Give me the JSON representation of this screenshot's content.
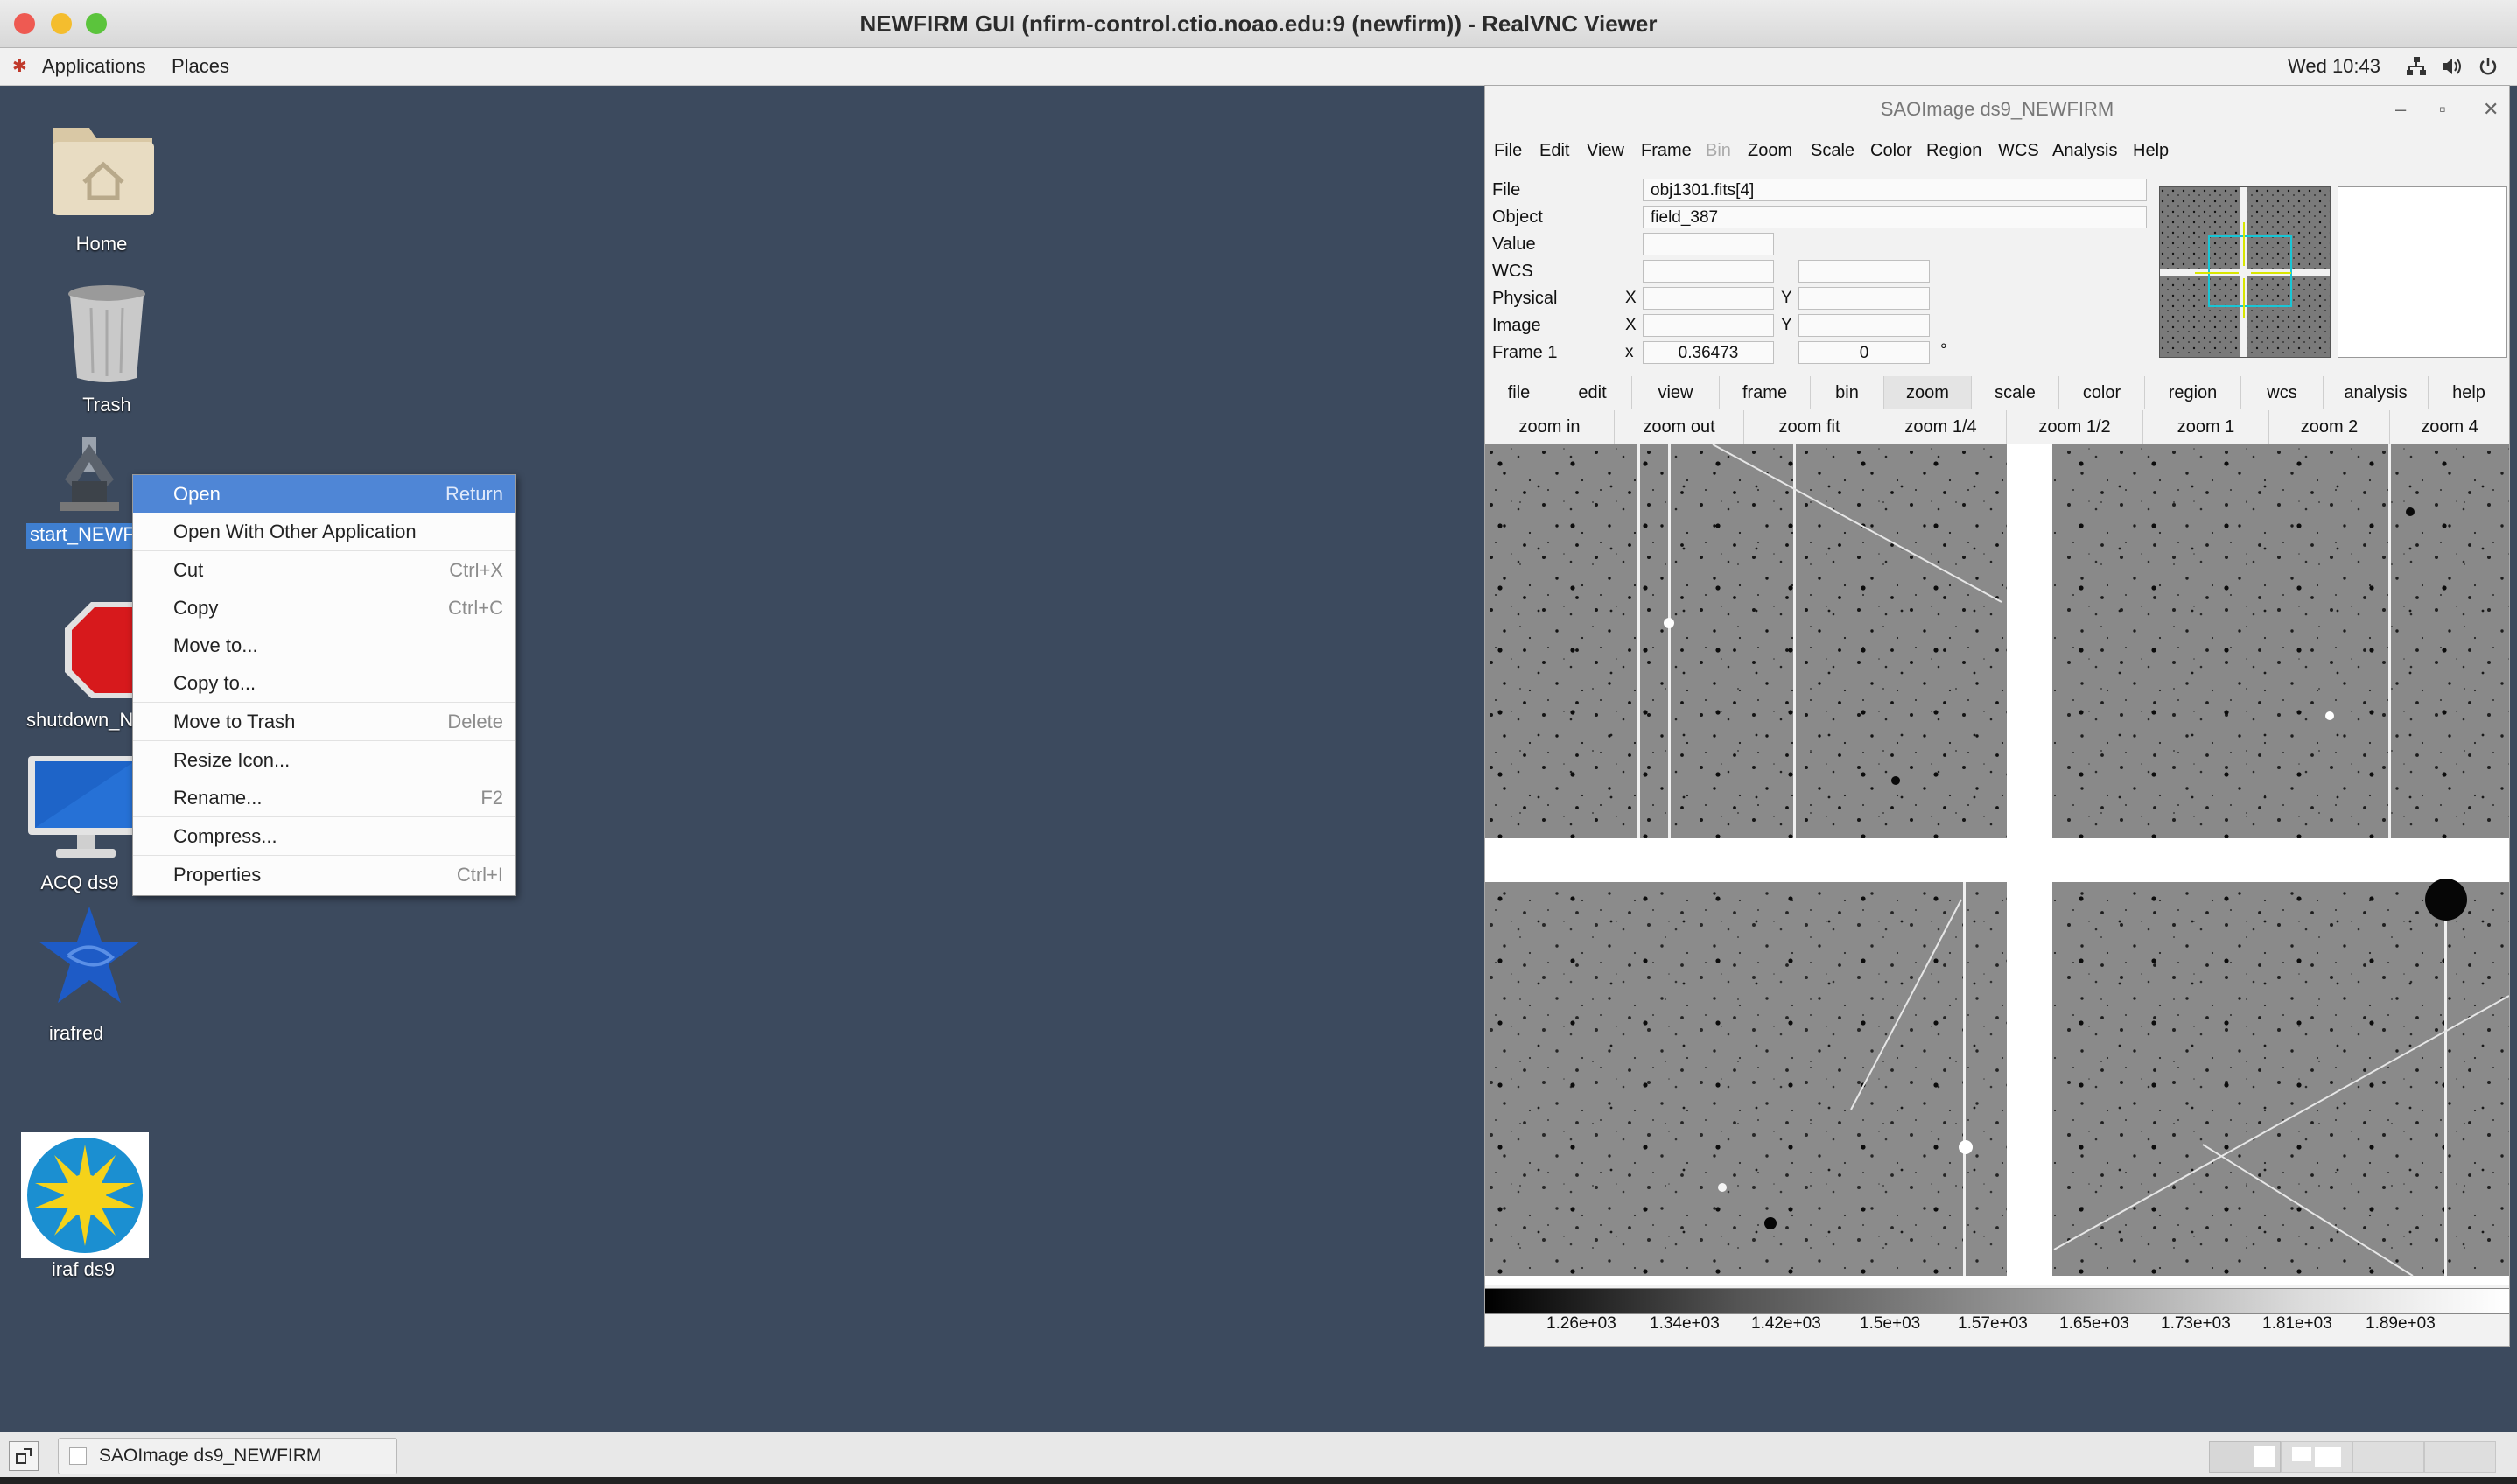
{
  "viewer": {
    "title": "NEWFIRM GUI (nfirm-control.ctio.noao.edu:9 (newfirm)) - RealVNC Viewer"
  },
  "topbar": {
    "applications": "Applications",
    "places": "Places",
    "clock": "Wed 10:43",
    "icons": [
      "network-icon",
      "volume-icon",
      "power-icon"
    ]
  },
  "desktop": {
    "icons": [
      {
        "label": "Home",
        "icon": "home-folder-icon"
      },
      {
        "label": "Trash",
        "icon": "trash-icon"
      },
      {
        "label": "start_NEWF",
        "icon": "telescope-icon",
        "selected": true
      },
      {
        "label": "shutdown_N",
        "icon": "stop-sign-icon"
      },
      {
        "label": "ACQ ds9",
        "icon": "monitor-icon"
      },
      {
        "label": "irafred",
        "icon": "iraf-star-icon"
      },
      {
        "label": "iraf ds9",
        "icon": "sun-icon"
      }
    ]
  },
  "context_menu": {
    "items": [
      {
        "label": "Open",
        "shortcut": "Return"
      },
      {
        "label": "Open With Other Application",
        "shortcut": ""
      },
      {
        "label": "Cut",
        "shortcut": "Ctrl+X"
      },
      {
        "label": "Copy",
        "shortcut": "Ctrl+C"
      },
      {
        "label": "Move to...",
        "shortcut": ""
      },
      {
        "label": "Copy to...",
        "shortcut": ""
      },
      {
        "label": "Move to Trash",
        "shortcut": "Delete"
      },
      {
        "label": "Resize Icon...",
        "shortcut": ""
      },
      {
        "label": "Rename...",
        "shortcut": "F2"
      },
      {
        "label": "Compress...",
        "shortcut": ""
      },
      {
        "label": "Properties",
        "shortcut": "Ctrl+I"
      }
    ]
  },
  "ds9": {
    "title": "SAOImage ds9_NEWFIRM",
    "window_buttons": {
      "minimize": "–",
      "maximize": "▫",
      "close": "✕"
    },
    "menubar": [
      "File",
      "Edit",
      "View",
      "Frame",
      "Bin",
      "Zoom",
      "Scale",
      "Color",
      "Region",
      "WCS",
      "Analysis",
      "Help"
    ],
    "info": {
      "file_label": "File",
      "file_value": "obj1301.fits[4]",
      "object_label": "Object",
      "object_value": "field_387",
      "value_label": "Value",
      "wcs_label": "WCS",
      "physical_label": "Physical",
      "image_label": "Image",
      "frame_label": "Frame 1",
      "x_label": "X",
      "y_label": "Y",
      "x_lower": "x",
      "frame_zoom": "0.36473",
      "frame_angle": "0",
      "degree": "°"
    },
    "buttonbar": [
      "file",
      "edit",
      "view",
      "frame",
      "bin",
      "zoom",
      "scale",
      "color",
      "region",
      "wcs",
      "analysis",
      "help"
    ],
    "zoombar": [
      "zoom in",
      "zoom out",
      "zoom fit",
      "zoom 1/4",
      "zoom 1/2",
      "zoom 1",
      "zoom 2",
      "zoom 4"
    ],
    "colorbar_ticks": [
      "1.26e+03",
      "1.34e+03",
      "1.42e+03",
      "1.5e+03",
      "1.57e+03",
      "1.65e+03",
      "1.73e+03",
      "1.81e+03",
      "1.89e+03"
    ]
  },
  "taskbar": {
    "task_label": "SAOImage ds9_NEWFIRM"
  },
  "colors": {
    "desktop": "#3c4a5e",
    "menu_highlight": "#4f86d6",
    "selection": "#3f7fd0"
  }
}
